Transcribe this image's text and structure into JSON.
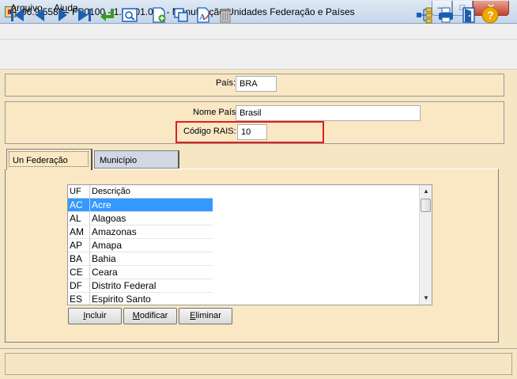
{
  "window": {
    "title": "06.9.5582 - FP0100 - 1.02.01.007 - Manutenção Unidades Federação e Países",
    "minimize_glyph": "—",
    "maximize_glyph": "□",
    "close_glyph": "✕"
  },
  "menu": {
    "arquivo_ul": "A",
    "arquivo_rest": "rquivo",
    "ajuda_pre": "Aj",
    "ajuda_ul": "u",
    "ajuda_rest": "da"
  },
  "toolbar": {
    "icons": [
      "first-record-icon",
      "previous-record-icon",
      "next-record-icon",
      "last-record-icon",
      "go-to-icon",
      "search-icon",
      "new-record-icon",
      "copy-record-icon",
      "edit-text-icon",
      "delete-icon",
      "tree-icon",
      "print-icon",
      "exit-icon",
      "help-icon"
    ]
  },
  "form": {
    "pais_label": "País:",
    "pais_value": "BRA",
    "nome_label": "Nome País:",
    "nome_value": "Brasil",
    "rais_label": "Código RAIS:",
    "rais_value": "10"
  },
  "tabs": [
    {
      "label": "Un Federação",
      "active": true
    },
    {
      "label": "Município",
      "active": false
    }
  ],
  "grid": {
    "columns": [
      "UF",
      "Descrição"
    ],
    "rows": [
      {
        "uf": "AC",
        "desc": "Acre",
        "selected": true
      },
      {
        "uf": "AL",
        "desc": "Alagoas"
      },
      {
        "uf": "AM",
        "desc": "Amazonas"
      },
      {
        "uf": "AP",
        "desc": "Amapa"
      },
      {
        "uf": "BA",
        "desc": "Bahia"
      },
      {
        "uf": "CE",
        "desc": "Ceara"
      },
      {
        "uf": "DF",
        "desc": "Distrito Federal"
      },
      {
        "uf": "ES",
        "desc": "Espirito Santo"
      }
    ]
  },
  "buttons": {
    "incluir_ul": "I",
    "incluir_rest": "ncluir",
    "modificar_ul": "M",
    "modificar_rest": "odificar",
    "eliminar_ul": "E",
    "eliminar_rest": "liminar"
  },
  "colors": {
    "form_bg": "#fae7c4",
    "selection": "#3399ff",
    "highlight_box": "#e01f1f",
    "toolbar_blue": "#1a5fb4"
  }
}
